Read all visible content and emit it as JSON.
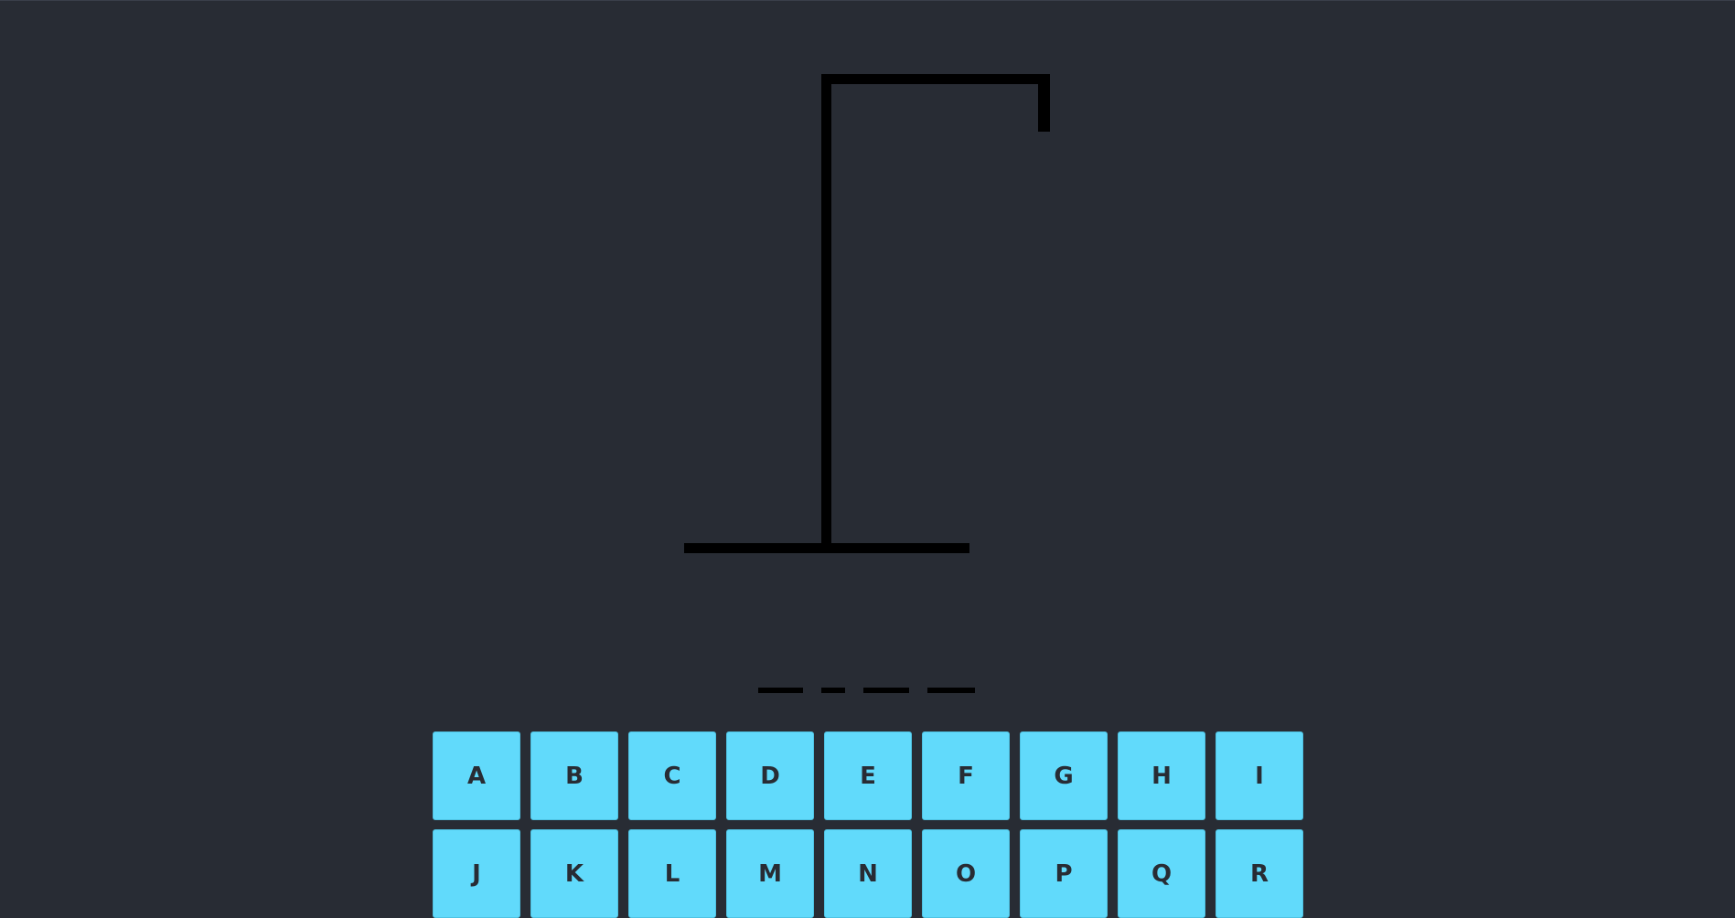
{
  "game": {
    "word_mask": [
      "_",
      "_",
      "_",
      "_"
    ],
    "keyboard": {
      "keys": [
        "A",
        "B",
        "C",
        "D",
        "E",
        "F",
        "G",
        "H",
        "I",
        "J",
        "K",
        "L",
        "M",
        "N",
        "O",
        "P",
        "Q",
        "R"
      ]
    }
  },
  "colors": {
    "background": "#282c34",
    "key_background": "#61dafb",
    "key_text": "#282c34",
    "gallows": "#000000"
  }
}
